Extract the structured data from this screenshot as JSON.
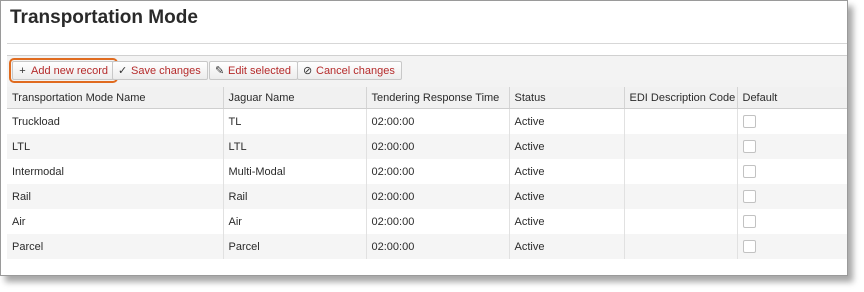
{
  "page": {
    "title": "Transportation Mode"
  },
  "toolbar": {
    "add_label": "Add new record",
    "save_label": "Save changes",
    "edit_label": "Edit selected",
    "cancel_label": "Cancel changes",
    "highlight_color": "#e06b1f"
  },
  "table": {
    "columns": [
      "Transportation Mode Name",
      "Jaguar Name",
      "Tendering Response Time",
      "Status",
      "EDI Description Code",
      "Default"
    ],
    "rows": [
      {
        "name": "Truckload",
        "jaguar": "TL",
        "response": "02:00:00",
        "status": "Active",
        "edi": "",
        "default": false
      },
      {
        "name": "LTL",
        "jaguar": "LTL",
        "response": "02:00:00",
        "status": "Active",
        "edi": "",
        "default": false
      },
      {
        "name": "Intermodal",
        "jaguar": "Multi-Modal",
        "response": "02:00:00",
        "status": "Active",
        "edi": "",
        "default": false
      },
      {
        "name": "Rail",
        "jaguar": "Rail",
        "response": "02:00:00",
        "status": "Active",
        "edi": "",
        "default": false
      },
      {
        "name": "Air",
        "jaguar": "Air",
        "response": "02:00:00",
        "status": "Active",
        "edi": "",
        "default": false
      },
      {
        "name": "Parcel",
        "jaguar": "Parcel",
        "response": "02:00:00",
        "status": "Active",
        "edi": "",
        "default": false
      }
    ]
  }
}
